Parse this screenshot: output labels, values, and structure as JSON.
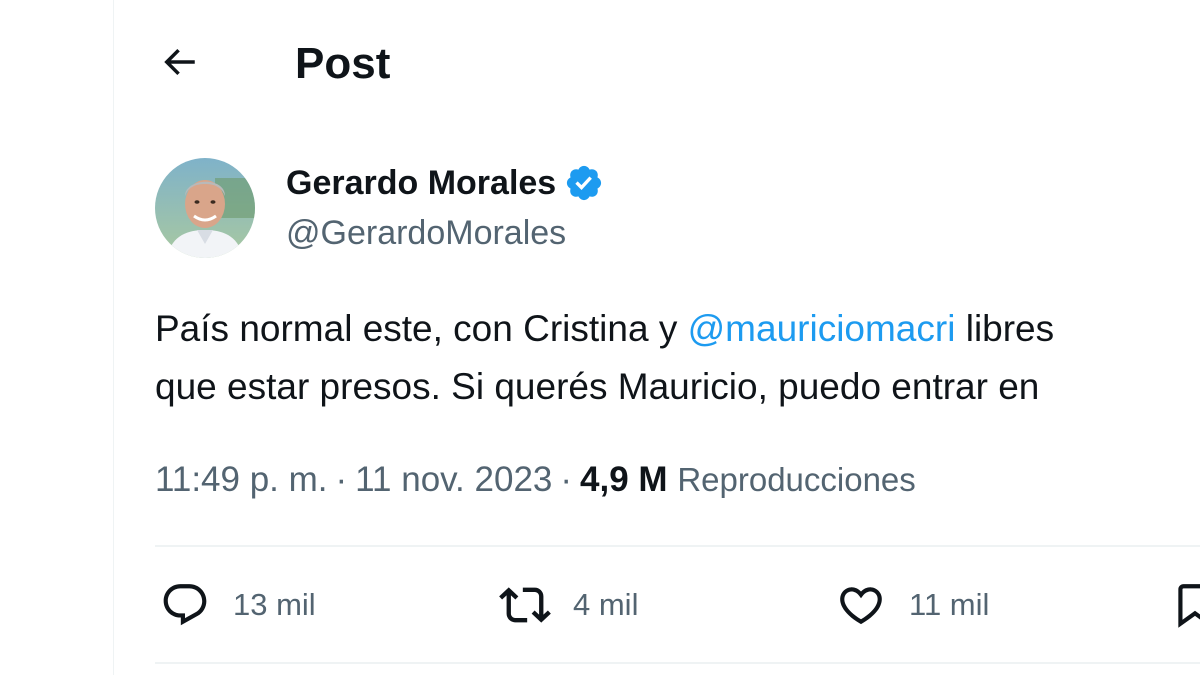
{
  "header": {
    "back_icon": "arrow-left-icon",
    "title": "Post"
  },
  "author": {
    "display_name": "Gerardo Morales",
    "handle": "@GerardoMorales",
    "verified": true,
    "verified_color": "#1d9bf0",
    "avatar": "profile-photo"
  },
  "tweet": {
    "line1_before": "País normal este, con Cristina y ",
    "mention": "@mauriciomacri",
    "line1_after": " libres",
    "line2": "que estar presos. Si querés Mauricio, puedo entrar en"
  },
  "meta": {
    "time": "11:49 p. m.",
    "separator": "·",
    "date": "11 nov. 2023",
    "views_count": "4,9 M",
    "views_label": "Reproducciones"
  },
  "actions": {
    "reply": {
      "icon": "reply-icon",
      "count": "13 mil"
    },
    "retweet": {
      "icon": "retweet-icon",
      "count": "4 mil"
    },
    "like": {
      "icon": "heart-icon",
      "count": "11 mil"
    },
    "bookmark": {
      "icon": "bookmark-icon"
    }
  },
  "colors": {
    "text": "#0f1419",
    "secondary": "#536471",
    "link": "#1d9bf0",
    "divider": "#eff3f4"
  }
}
